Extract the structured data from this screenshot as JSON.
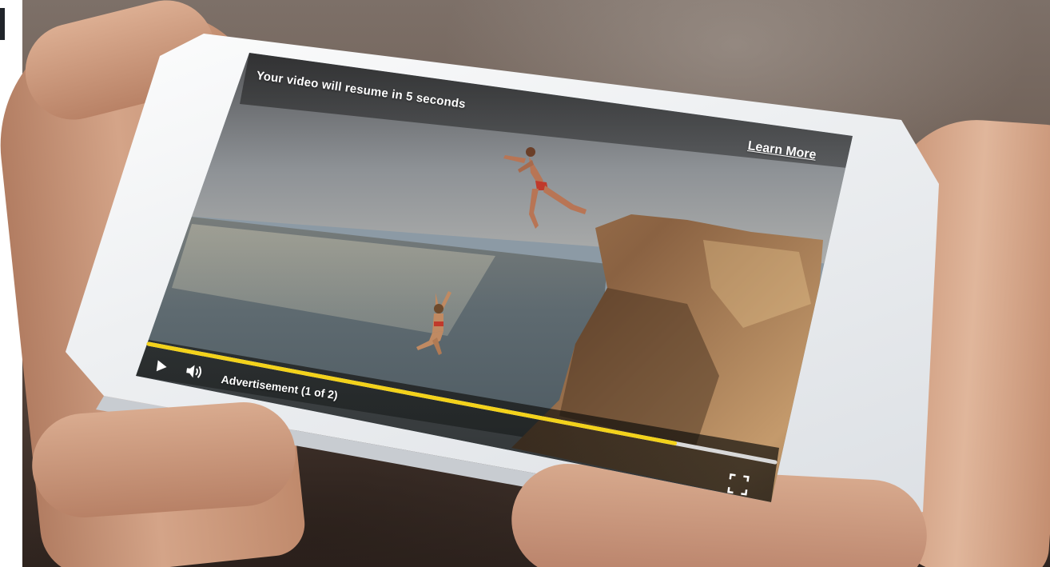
{
  "ad_overlay": {
    "resume_notice": "Your video will resume in 5 seconds",
    "learn_more_label": "Learn More",
    "ad_label": "Advertisement (1 of 2)"
  },
  "player": {
    "progress_fraction": 0.84,
    "progress_color": "#f3d21b",
    "track_color": "#d9d9d9",
    "play_icon": "play-icon",
    "volume_icon": "volume-icon",
    "fullscreen_icon": "fullscreen-icon"
  }
}
